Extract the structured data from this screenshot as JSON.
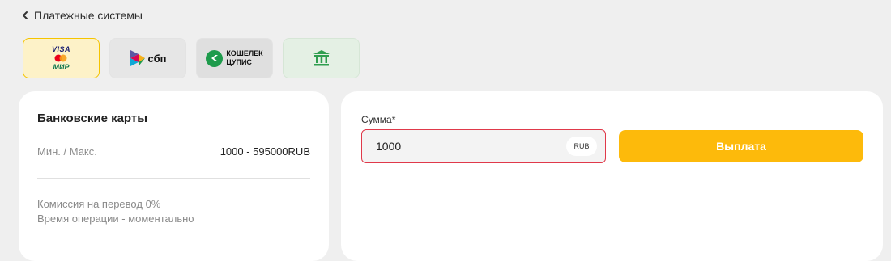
{
  "header": {
    "title": "Платежные системы",
    "back_icon": "chevron-left-icon"
  },
  "methods": [
    {
      "id": "bank-cards",
      "logo_top": "VISA",
      "logo_bottom": "МИР",
      "selected": true
    },
    {
      "id": "sbp",
      "logo_text": "сбп"
    },
    {
      "id": "cupis",
      "line1": "КОШЕЛЕК",
      "line2": "ЦУПИС"
    },
    {
      "id": "bank",
      "icon": "bank-icon"
    }
  ],
  "info": {
    "title": "Банковские карты",
    "limits_label": "Мин. / Макс.",
    "limits_value": "1000 - 595000RUB",
    "commission": "Комиссия на перевод 0%",
    "operation_time": "Время операции - моментально"
  },
  "form": {
    "amount_label": "Сумма*",
    "amount_value": "1000",
    "currency": "RUB",
    "submit_label": "Выплата"
  },
  "colors": {
    "accent": "#fdba0b",
    "error_border": "#e0394a",
    "background": "#efefef"
  }
}
